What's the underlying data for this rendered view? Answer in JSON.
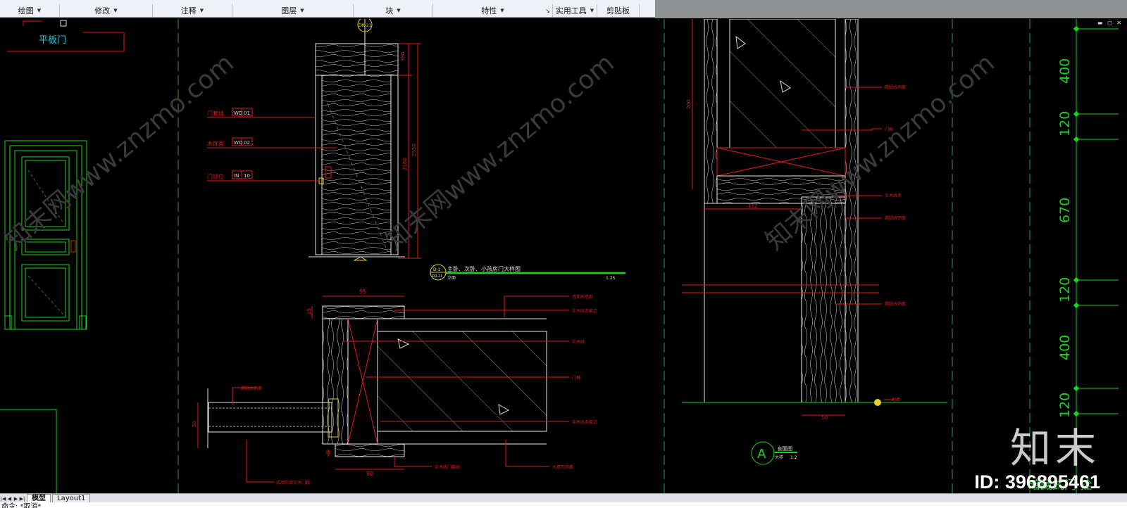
{
  "ribbon": {
    "panels": [
      "绘图",
      "修改",
      "注释",
      "图层",
      "块",
      "特性",
      "实用工具",
      "剪贴板"
    ]
  },
  "drawing": {
    "door_label": "平板门",
    "tags": [
      {
        "name": "门套线",
        "code": "WD",
        "num": "01"
      },
      {
        "name": "木饰面",
        "code": "WD",
        "num": "02"
      },
      {
        "name": "门锁位",
        "code": "IN",
        "num": "10"
      }
    ],
    "dims_elevation": [
      "390",
      "2550",
      "2160"
    ],
    "detail_symbol_top": "DR-21",
    "title_block": {
      "ref": "D-1",
      "sheet": "DR-21",
      "title": "主卧、次卧、小孩房门大样图",
      "scale_label": "立面",
      "scale": "1:25"
    },
    "plan_dims": [
      "95",
      "15",
      "50",
      "15",
      "80"
    ],
    "plan_notes": [
      "墙布刷墙纸",
      "实木线条套边",
      "实木线",
      "门框",
      "实木线条套边",
      "大理石饰面",
      "实木线门套线",
      "成品防腐实木门套",
      "踢脚线饰面"
    ],
    "section_dims": [
      "200",
      "112",
      "50"
    ],
    "section_notes": [
      "踢脚线饰面",
      "门框",
      "实木线条",
      "踢脚线饰面",
      "踢脚线饰面",
      "地面"
    ],
    "section_symbol": {
      "letter": "A",
      "title": "剖面图",
      "scale_label": "大样",
      "scale": "1:2"
    },
    "right_dims": [
      "400",
      "120",
      "670",
      "120",
      "400",
      "120"
    ],
    "watermark": "知末网www.znzmo.com",
    "corner_text": "暗藏式门 拴"
  },
  "tabs": {
    "model": "模型",
    "layout": "Layout1"
  },
  "command": "命令: *取消*",
  "brand": {
    "logo": "知末",
    "id": "ID: 396895461"
  },
  "colors": {
    "white": "#e6e6e6",
    "red": "#e01b1b",
    "green": "#19d519",
    "yellow": "#e5d230",
    "dashgreen": "#1faa3a"
  }
}
